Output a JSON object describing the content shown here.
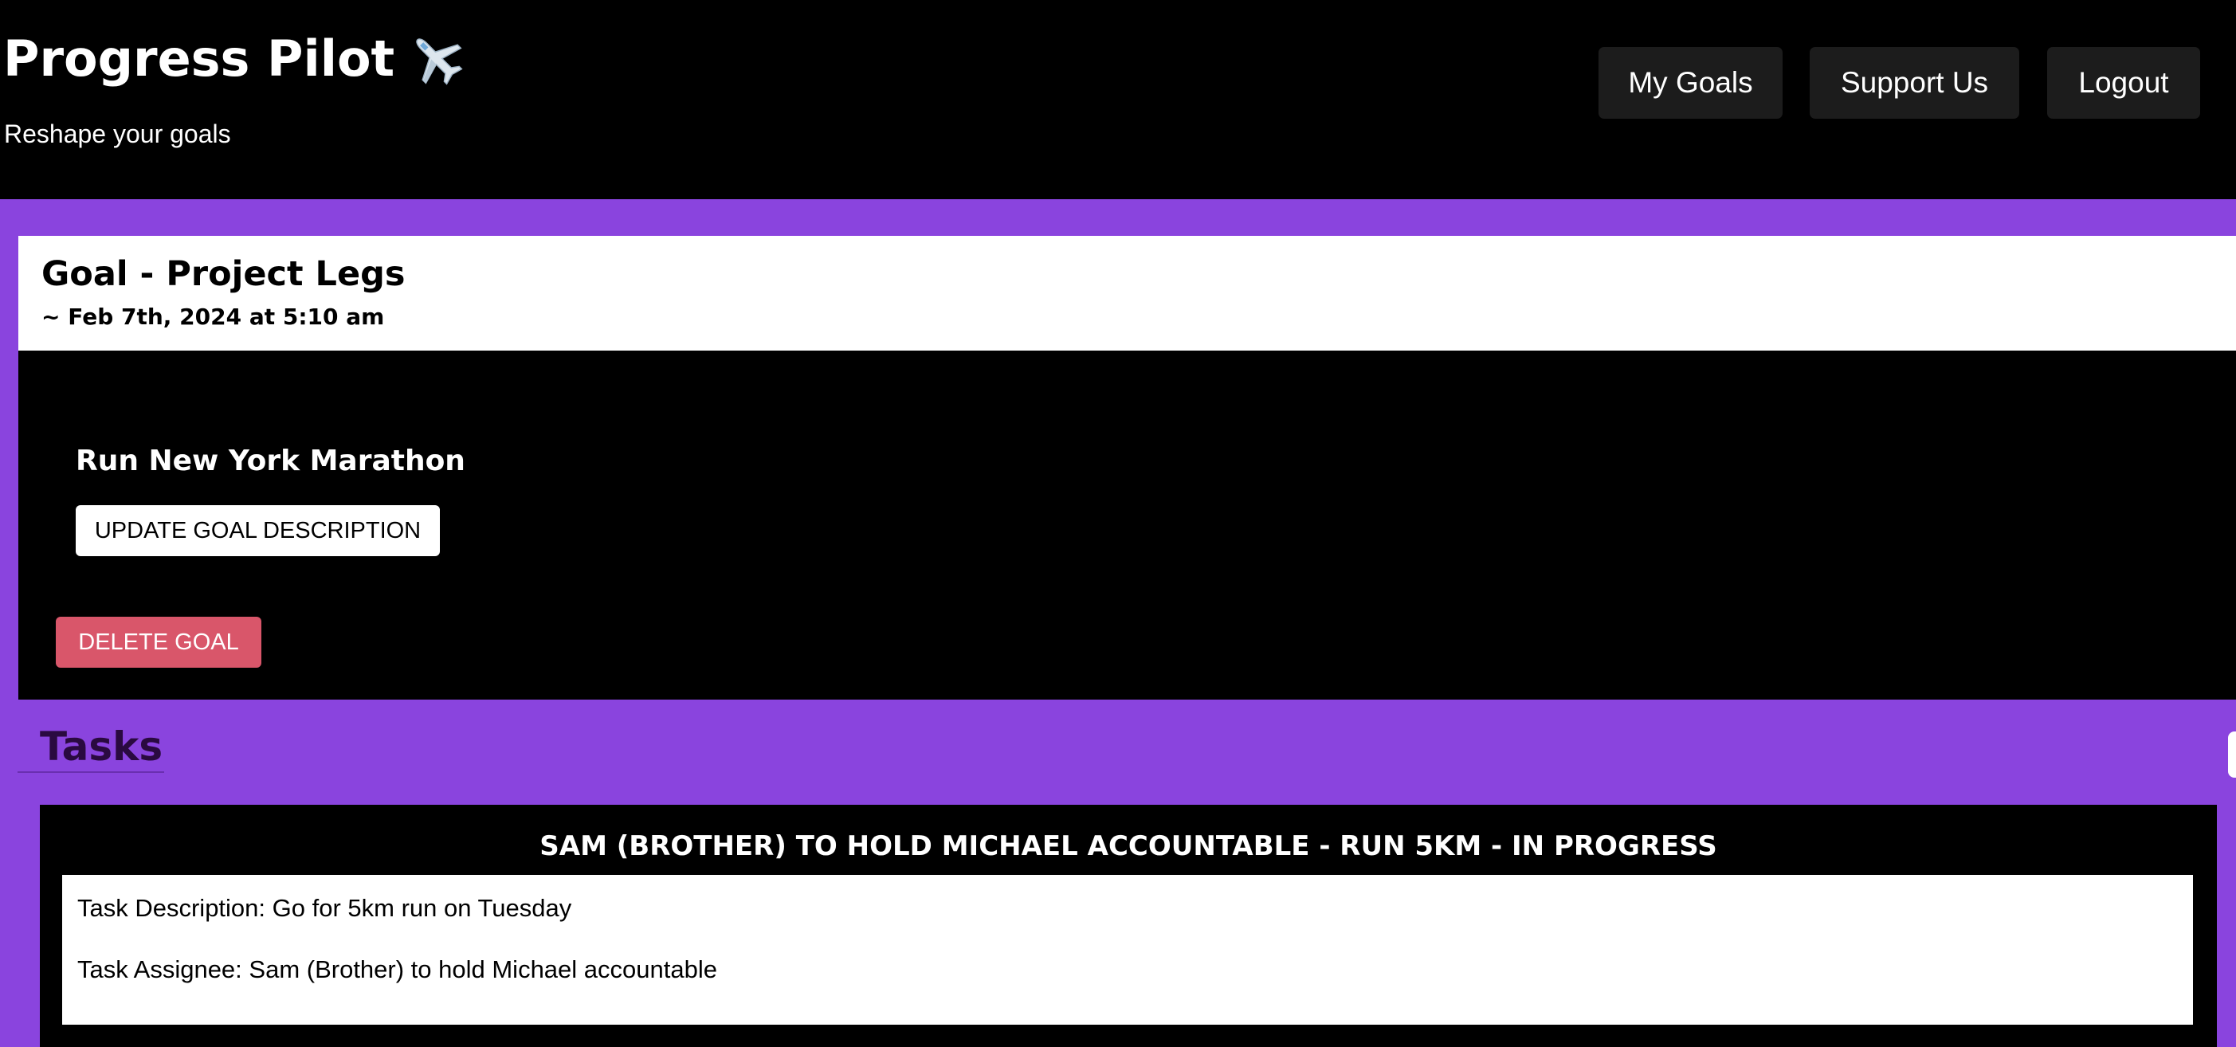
{
  "header": {
    "app_title": "Progress Pilot",
    "app_icon": "airplane-icon",
    "subtitle": "Reshape your goals",
    "nav": {
      "my_goals": "My Goals",
      "support_us": "Support Us",
      "logout": "Logout"
    }
  },
  "goal": {
    "title": "Goal - Project Legs",
    "date": "~ Feb 7th, 2024 at 5:10 am",
    "description": "Run New York Marathon",
    "update_label": "UPDATE GOAL DESCRIPTION",
    "delete_label": "DELETE GOAL"
  },
  "tasks": {
    "heading": "Tasks",
    "items": [
      {
        "header": "SAM (BROTHER) TO HOLD MICHAEL ACCOUNTABLE - RUN 5KM - IN PROGRESS",
        "description": "Task Description: Go for 5km run on Tuesday",
        "assignee": "Task Assignee: Sam (Brother) to hold Michael accountable"
      }
    ]
  },
  "colors": {
    "page_background": "#8a44de",
    "header_background": "#000000",
    "nav_button": "#1c1c1c",
    "delete_button": "#d9566a"
  }
}
